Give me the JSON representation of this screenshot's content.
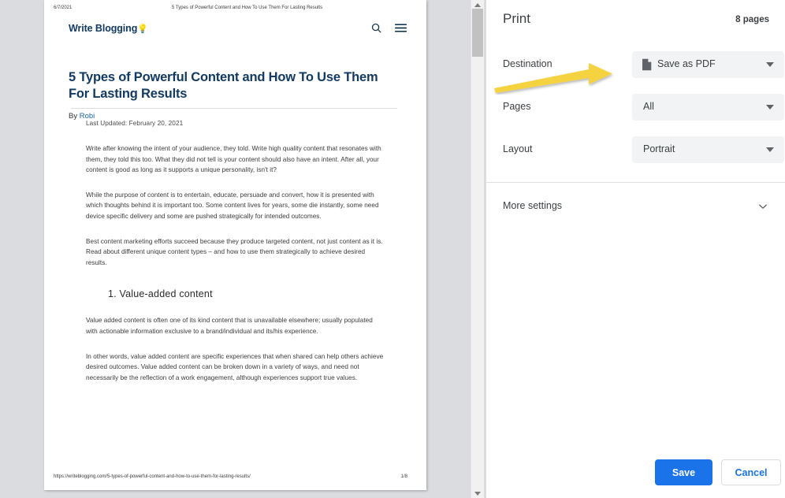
{
  "preview": {
    "doc_header": {
      "date": "6/7/2021",
      "title": "5 Types of Powerful Content and How To Use Them For Lasting Results"
    },
    "doc_footer": {
      "url": "https://writeblogging.com/5-types-of-powerful-content-and-how-to-use-them-for-lasting-results/",
      "page_indicator": "1/8"
    },
    "site": {
      "logo_text": "Write Blogging",
      "logo_emoji": "💡",
      "search_icon": "search-icon",
      "menu_icon": "hamburger-menu-icon"
    },
    "article": {
      "title": "5 Types of Powerful Content and How To Use Them For Lasting Results",
      "byline_prefix": "By ",
      "author": "Robi",
      "last_updated": "Last Updated: February 20, 2021",
      "paragraph_1": "Write after knowing the intent of your audience, they told. Write high quality content that resonates with them, they told this too. What they did not tell is your content should also have an intent. After all, your content is good as long as it supports a unique personality, isn't it?",
      "paragraph_2": "While the purpose of content is to entertain, educate, persuade and convert, how it is presented with which thoughts behind it is important too. Some content lives for years, some die instantly, some need device specific delivery and some are pushed strategically for intended outcomes.",
      "paragraph_3": "Best content marketing efforts succeed because they produce targeted content, not just content as it is. Read about different unique content types – and how to use them strategically to achieve desired results.",
      "section_heading": "1. Value-added content",
      "paragraph_4": "Value added content is often one of its kind content that is unavailable elsewhere; usually populated with actionable information exclusive to a brand/individual and its/his experience.",
      "paragraph_5": "In other words, value added content are specific experiences that when shared can help others achieve desired outcomes. Value added content can be broken down in a variety of ways, and need not necessarily be the reflection of a work engagement, although experiences support true values."
    },
    "scrollbar": {
      "up_arrow": "scroll-up-arrow-icon",
      "down_arrow": "scroll-down-arrow-icon"
    }
  },
  "print_dialog": {
    "title": "Print",
    "pages_count": "8 pages",
    "settings": [
      {
        "label": "Destination",
        "value": "Save as PDF",
        "icon": "pdf-document-icon",
        "has_icon": true
      },
      {
        "label": "Pages",
        "value": "All",
        "has_icon": false
      },
      {
        "label": "Layout",
        "value": "Portrait",
        "has_icon": false
      }
    ],
    "more_settings": {
      "label": "More settings",
      "icon": "chevron-down-icon"
    },
    "actions": {
      "save_label": "Save",
      "cancel_label": "Cancel"
    }
  },
  "annotation": {
    "arrow_color": "#f5d341",
    "points_to": "Destination"
  },
  "colors": {
    "accent_blue": "#1a73e8",
    "select_bg": "#f1f3f4",
    "text_primary": "#3c4043",
    "preview_bg": "#dadce0",
    "brand_navy": "#123a63",
    "link_blue": "#1966a8",
    "arrow_yellow": "#f5d341"
  }
}
